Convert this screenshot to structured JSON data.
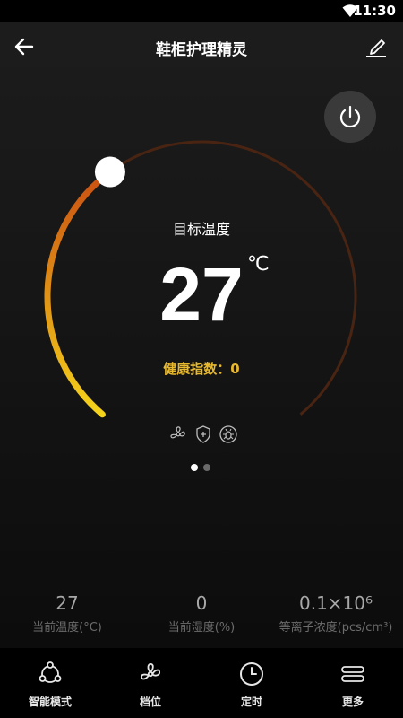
{
  "status_bar": {
    "time": "11:30"
  },
  "header": {
    "title": "鞋柜护理精灵"
  },
  "dial": {
    "label": "目标温度",
    "value": "27",
    "unit": "℃",
    "health_label": "健康指数：",
    "health_value": "0",
    "level_fraction": 0.37
  },
  "pager": {
    "count": 2,
    "active": 0
  },
  "stats": [
    {
      "value": "27",
      "label": "当前温度(°C)"
    },
    {
      "value": "0",
      "label": "当前湿度(%)"
    },
    {
      "value": "0.1×10⁶",
      "label": "等离子浓度(pcs/cm³)"
    }
  ],
  "nav": [
    {
      "label": "智能模式",
      "icon": "smart-mode-icon"
    },
    {
      "label": "档位",
      "icon": "fan-icon"
    },
    {
      "label": "定时",
      "icon": "clock-icon"
    },
    {
      "label": "更多",
      "icon": "menu-icon"
    }
  ],
  "colors": {
    "arc_track": "#4a2412",
    "arc_start": "#f5d31b",
    "arc_end": "#c94f12",
    "health": "#e8b92e"
  }
}
